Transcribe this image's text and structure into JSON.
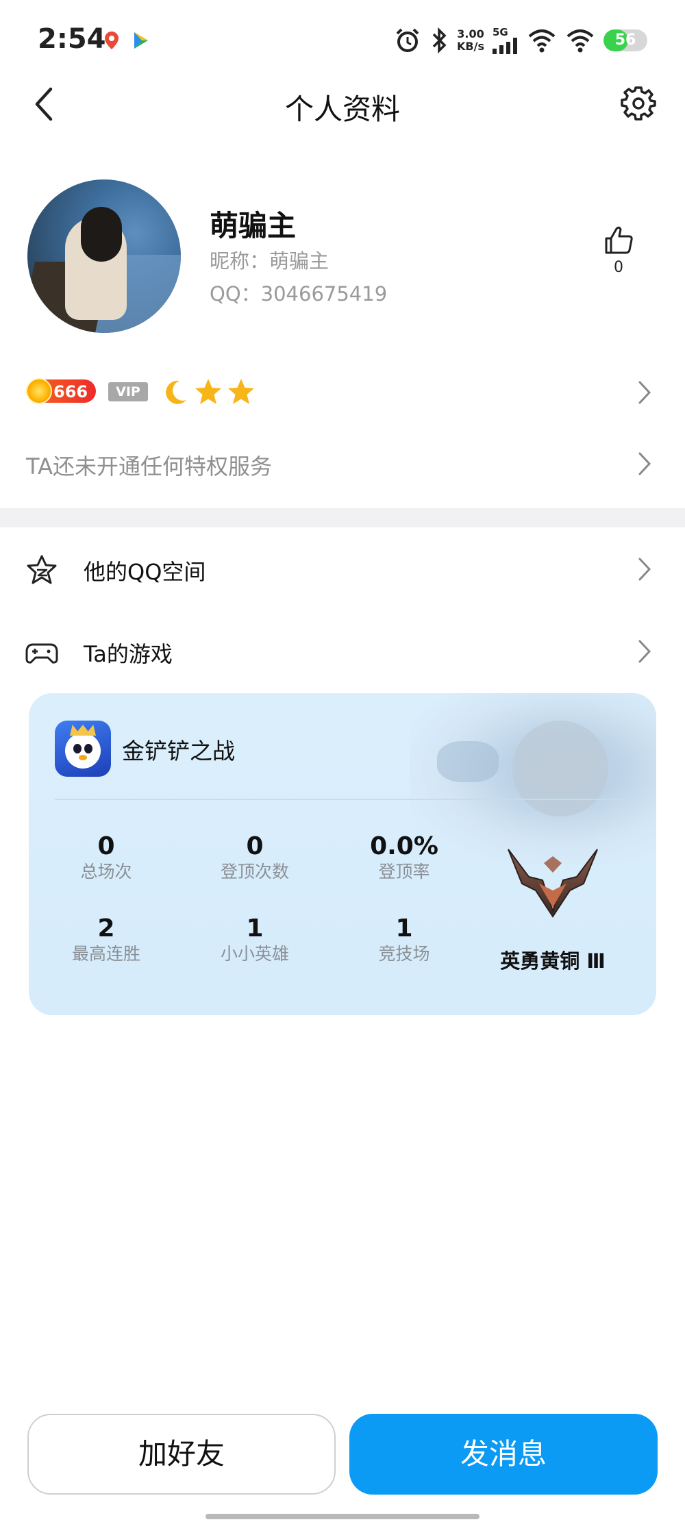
{
  "status_bar": {
    "time": "2:54",
    "net_speed_value": "3.00",
    "net_speed_unit": "KB/s",
    "network_type": "5G",
    "battery": "56",
    "battery_level": 0.56
  },
  "nav": {
    "title": "个人资料"
  },
  "profile": {
    "display_name": "萌骗主",
    "nickname": "昵称：萌骗主",
    "qq": "QQ：3046675419",
    "like_count": "0"
  },
  "badges": {
    "level": "666",
    "vip": "VIP"
  },
  "privilege": {
    "text": "TA还未开通任何特权服务"
  },
  "menu": {
    "qzone": "他的QQ空间",
    "games": "Ta的游戏"
  },
  "game_card": {
    "name": "金铲铲之战",
    "stats": [
      {
        "value": "0",
        "label": "总场次"
      },
      {
        "value": "0",
        "label": "登顶次数"
      },
      {
        "value": "0.0%",
        "label": "登顶率"
      },
      {
        "value": "2",
        "label": "最高连胜"
      },
      {
        "value": "1",
        "label": "小小英雄"
      },
      {
        "value": "1",
        "label": "竞技场"
      }
    ],
    "rank": "英勇黄铜 Ⅲ"
  },
  "actions": {
    "add_friend": "加好友",
    "send_message": "发消息"
  },
  "colors": {
    "accent_blue": "#0b9bf5",
    "level_badge": "#f46a1c",
    "card_bg": "#d8edfb"
  }
}
